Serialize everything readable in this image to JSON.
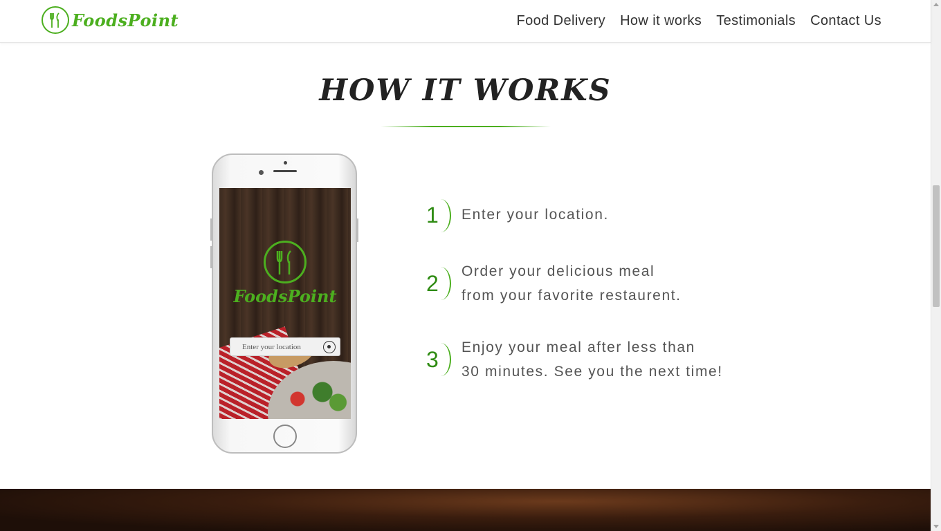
{
  "nav": {
    "brand": "FoodsPoint",
    "items": [
      {
        "label": "Food Delivery"
      },
      {
        "label": "How it works"
      },
      {
        "label": "Testimonials"
      },
      {
        "label": "Contact Us"
      }
    ]
  },
  "section": {
    "title": "HOW IT WORKS"
  },
  "phone": {
    "brand": "FoodsPoint",
    "input_placeholder": "Enter your location"
  },
  "steps": [
    {
      "number": "1",
      "lines": [
        "Enter your location."
      ]
    },
    {
      "number": "2",
      "lines": [
        "Order your delicious meal",
        "from your favorite restaurent."
      ]
    },
    {
      "number": "3",
      "lines": [
        "Enjoy your meal after less than",
        "30 minutes. See you the next time!"
      ]
    }
  ],
  "colors": {
    "brand_green": "#4caf1f",
    "step_green": "#2e8b12"
  },
  "icons": {
    "logo": "fork-knife-icon",
    "location": "location-pin-icon"
  }
}
